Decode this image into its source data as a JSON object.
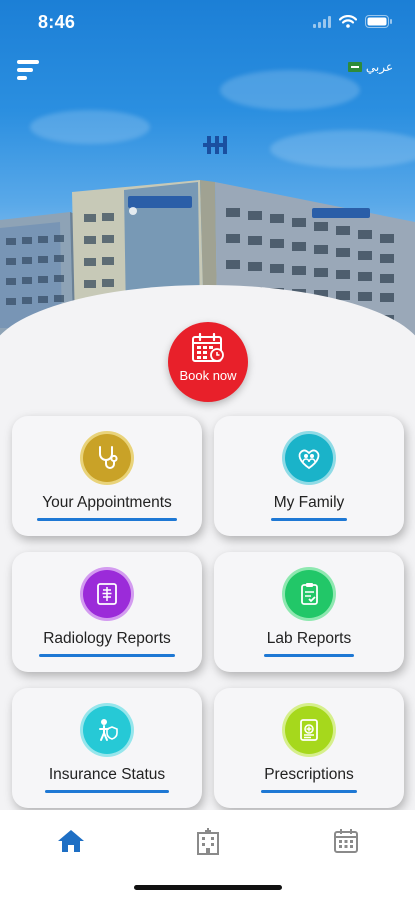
{
  "status_bar": {
    "time": "8:46"
  },
  "header": {
    "language_label": "عربي"
  },
  "hero": {
    "book_now_label": "Book now"
  },
  "cards": [
    {
      "label": "Your Appointments",
      "icon": "stethoscope-icon",
      "color": "#c9a227"
    },
    {
      "label": "My Family",
      "icon": "family-heart-icon",
      "color": "#1ab3c9"
    },
    {
      "label": "Radiology Reports",
      "icon": "radiology-icon",
      "color": "#9b2bd9"
    },
    {
      "label": "Lab Reports",
      "icon": "lab-report-icon",
      "color": "#22c768"
    },
    {
      "label": "Insurance Status",
      "icon": "insurance-icon",
      "color": "#26c9d6"
    },
    {
      "label": "Prescriptions",
      "icon": "prescription-icon",
      "color": "#a6d81c"
    }
  ],
  "tabbar": {
    "items": [
      {
        "icon": "home-icon",
        "active": true
      },
      {
        "icon": "hospital-building-icon",
        "active": false
      },
      {
        "icon": "calendar-icon",
        "active": false
      }
    ],
    "active_color": "#1e6fc4",
    "inactive_color": "#8a8a8a"
  },
  "colors": {
    "accent": "#1e78d4",
    "book_now": "#e8202a"
  }
}
